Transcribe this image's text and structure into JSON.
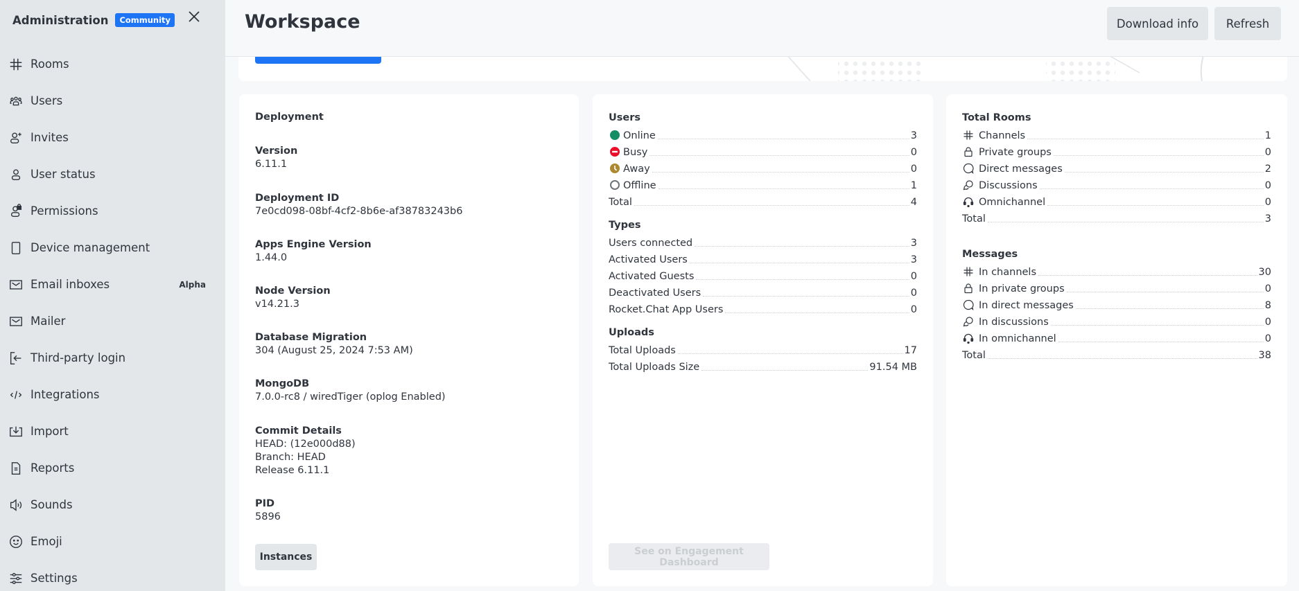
{
  "sidebar": {
    "title": "Administration",
    "badge": "Community",
    "items": [
      {
        "label": "Rooms",
        "icon": "hashtag-icon"
      },
      {
        "label": "Users",
        "icon": "team-icon"
      },
      {
        "label": "Invites",
        "icon": "user-plus-icon"
      },
      {
        "label": "User status",
        "icon": "user-icon"
      },
      {
        "label": "Permissions",
        "icon": "user-lock-icon"
      },
      {
        "label": "Device management",
        "icon": "mobile-icon"
      },
      {
        "label": "Email inboxes",
        "icon": "mail-icon",
        "tag": "Alpha"
      },
      {
        "label": "Mailer",
        "icon": "mail-icon"
      },
      {
        "label": "Third-party login",
        "icon": "login-icon"
      },
      {
        "label": "Integrations",
        "icon": "code-icon"
      },
      {
        "label": "Import",
        "icon": "download-icon"
      },
      {
        "label": "Reports",
        "icon": "file-icon"
      },
      {
        "label": "Sounds",
        "icon": "speaker-icon"
      },
      {
        "label": "Emoji",
        "icon": "emoji-icon"
      },
      {
        "label": "Settings",
        "icon": "customize-icon"
      }
    ]
  },
  "header": {
    "title": "Workspace",
    "download_label": "Download info",
    "refresh_label": "Refresh"
  },
  "deployment": {
    "title": "Deployment",
    "fields": [
      {
        "label": "Version",
        "value": "6.11.1"
      },
      {
        "label": "Deployment ID",
        "value": "7e0cd098-08bf-4cf2-8b6e-af38783243b6"
      },
      {
        "label": "Apps Engine Version",
        "value": "1.44.0"
      },
      {
        "label": "Node Version",
        "value": "v14.21.3"
      },
      {
        "label": "Database Migration",
        "value": "304 (August 25, 2024 7:53 AM)"
      },
      {
        "label": "MongoDB",
        "value": "7.0.0-rc8 / wiredTiger (oplog Enabled)"
      },
      {
        "label": "Commit Details",
        "lines": [
          "HEAD: (12e000d88)",
          "Branch: HEAD",
          "Release 6.11.1"
        ]
      },
      {
        "label": "PID",
        "value": "5896"
      }
    ],
    "instances_label": "Instances"
  },
  "users_card": {
    "users": {
      "title": "Users",
      "rows": [
        {
          "label": "Online",
          "value": "3",
          "status": "online",
          "color": "#158d65"
        },
        {
          "label": "Busy",
          "value": "0",
          "status": "busy",
          "color": "#ec0d2a"
        },
        {
          "label": "Away",
          "value": "0",
          "status": "away",
          "color": "#ac892f"
        },
        {
          "label": "Offline",
          "value": "1",
          "status": "offline",
          "color": "#6c727a"
        },
        {
          "label": "Total",
          "value": "4"
        }
      ]
    },
    "types": {
      "title": "Types",
      "rows": [
        {
          "label": "Users connected",
          "value": "3"
        },
        {
          "label": "Activated Users",
          "value": "3"
        },
        {
          "label": "Activated Guests",
          "value": "0"
        },
        {
          "label": "Deactivated Users",
          "value": "0"
        },
        {
          "label": "Rocket.Chat App Users",
          "value": "0"
        }
      ]
    },
    "uploads": {
      "title": "Uploads",
      "rows": [
        {
          "label": "Total Uploads",
          "value": "17"
        },
        {
          "label": "Total Uploads Size",
          "value": "91.54 MB"
        }
      ]
    },
    "engagement_label": "See on Engagement Dashboard"
  },
  "rooms_card": {
    "rooms": {
      "title": "Total Rooms",
      "rows": [
        {
          "label": "Channels",
          "value": "1",
          "icon": "hashtag-icon"
        },
        {
          "label": "Private groups",
          "value": "0",
          "icon": "lock-icon"
        },
        {
          "label": "Direct messages",
          "value": "2",
          "icon": "chat-icon"
        },
        {
          "label": "Discussions",
          "value": "0",
          "icon": "discussion-icon"
        },
        {
          "label": "Omnichannel",
          "value": "0",
          "icon": "headset-icon"
        },
        {
          "label": "Total",
          "value": "3"
        }
      ]
    },
    "messages": {
      "title": "Messages",
      "rows": [
        {
          "label": "In channels",
          "value": "30",
          "icon": "hashtag-icon"
        },
        {
          "label": "In private groups",
          "value": "0",
          "icon": "lock-icon"
        },
        {
          "label": "In direct messages",
          "value": "8",
          "icon": "chat-icon"
        },
        {
          "label": "In discussions",
          "value": "0",
          "icon": "discussion-icon"
        },
        {
          "label": "In omnichannel",
          "value": "0",
          "icon": "headset-icon"
        },
        {
          "label": "Total",
          "value": "38"
        }
      ]
    }
  },
  "colors": {
    "brand": "#1d74f5",
    "sidebar_bg": "#e4e7ea",
    "page_bg": "#f7f8fa",
    "text": "#2f343d"
  }
}
